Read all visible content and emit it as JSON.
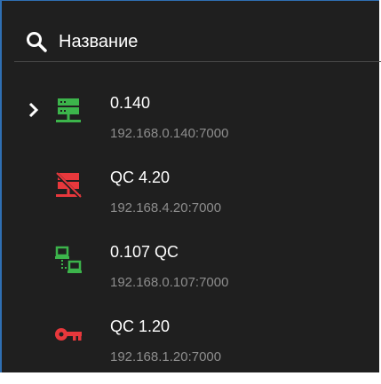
{
  "search": {
    "placeholder": "Название"
  },
  "colors": {
    "panel_bg": "#1f1f1f",
    "online_green": "#3cb44b",
    "alert_red": "#e8383c",
    "address_gray": "#8d8d8d",
    "divider": "#4a4a4a"
  },
  "devices": [
    {
      "name": "0.140",
      "address": "192.168.0.140:7000",
      "icon": "server-online-icon",
      "expanded_indicator": "chevron-right-icon"
    },
    {
      "name": "QC 4.20",
      "address": "192.168.4.20:7000",
      "icon": "server-offline-icon"
    },
    {
      "name": "0.107 QC",
      "address": "192.168.0.107:7000",
      "icon": "network-connected-icon"
    },
    {
      "name": "QC 1.20",
      "address": "192.168.1.20:7000",
      "icon": "key-icon"
    }
  ]
}
